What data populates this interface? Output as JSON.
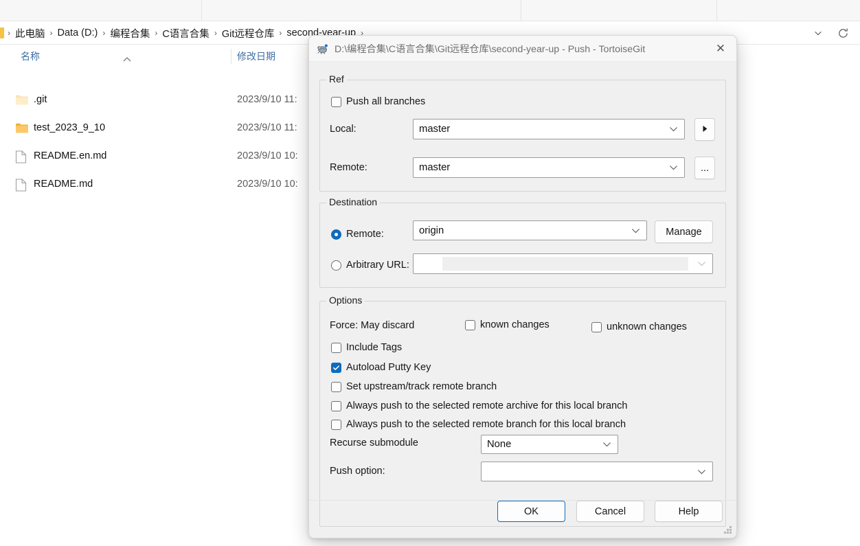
{
  "explorer": {
    "breadcrumb": {
      "items": [
        "此电脑",
        "Data (D:)",
        "编程合集",
        "C语言合集",
        "Git远程仓库",
        "second-year-up"
      ],
      "separator": "›"
    },
    "columns": [
      "名称",
      "修改日期"
    ],
    "files": [
      {
        "name": ".git",
        "date": "2023/9/10 11:",
        "icon": "folder-dim-icon"
      },
      {
        "name": "test_2023_9_10",
        "date": "2023/9/10 11:",
        "icon": "folder-icon"
      },
      {
        "name": "README.en.md",
        "date": "2023/9/10 10:",
        "icon": "file-icon"
      },
      {
        "name": "README.md",
        "date": "2023/9/10 10:",
        "icon": "file-icon"
      }
    ],
    "toolbar_icons": [
      "chevron-down-icon",
      "refresh-icon"
    ]
  },
  "dialog": {
    "title": "D:\\编程合集\\C语言合集\\Git远程仓库\\second-year-up - Push - TortoiseGit",
    "app_icon": "tortoisegit-turtle-icon",
    "close_label": "✕",
    "ref": {
      "group_label": "Ref",
      "push_all_label": "Push all branches",
      "push_all_checked": false,
      "local_label": "Local:",
      "local_value": "master",
      "local_browse_icon": "play-triangle-icon",
      "remote_label": "Remote:",
      "remote_value": "master",
      "remote_browse_label": "..."
    },
    "destination": {
      "group_label": "Destination",
      "remote_label": "Remote:",
      "remote_selected": true,
      "remote_value": "origin",
      "manage_label": "Manage",
      "url_label": "Arbitrary URL:",
      "url_selected": false,
      "url_value": ""
    },
    "options": {
      "group_label": "Options",
      "force_label": "Force: May discard",
      "known_label": "known changes",
      "known_checked": false,
      "unknown_label": "unknown changes",
      "unknown_checked": false,
      "include_tags_label": "Include Tags",
      "include_tags_checked": false,
      "autoload_putty_label": "Autoload Putty Key",
      "autoload_putty_checked": true,
      "set_upstream_label": "Set upstream/track remote branch",
      "set_upstream_checked": false,
      "always_archive_label": "Always push to the selected remote archive for this local branch",
      "always_archive_checked": false,
      "always_branch_label": "Always push to the selected remote branch for this local branch",
      "always_branch_checked": false,
      "recurse_label": "Recurse submodule",
      "recurse_value": "None",
      "push_option_label": "Push option:",
      "push_option_value": ""
    },
    "buttons": {
      "ok": "OK",
      "cancel": "Cancel",
      "help": "Help"
    }
  },
  "colors": {
    "accent": "#0f6cbd",
    "folder": "#f7c76a",
    "dialog_bg": "#f0f0f0",
    "column_header_text": "#3d6fa5"
  }
}
